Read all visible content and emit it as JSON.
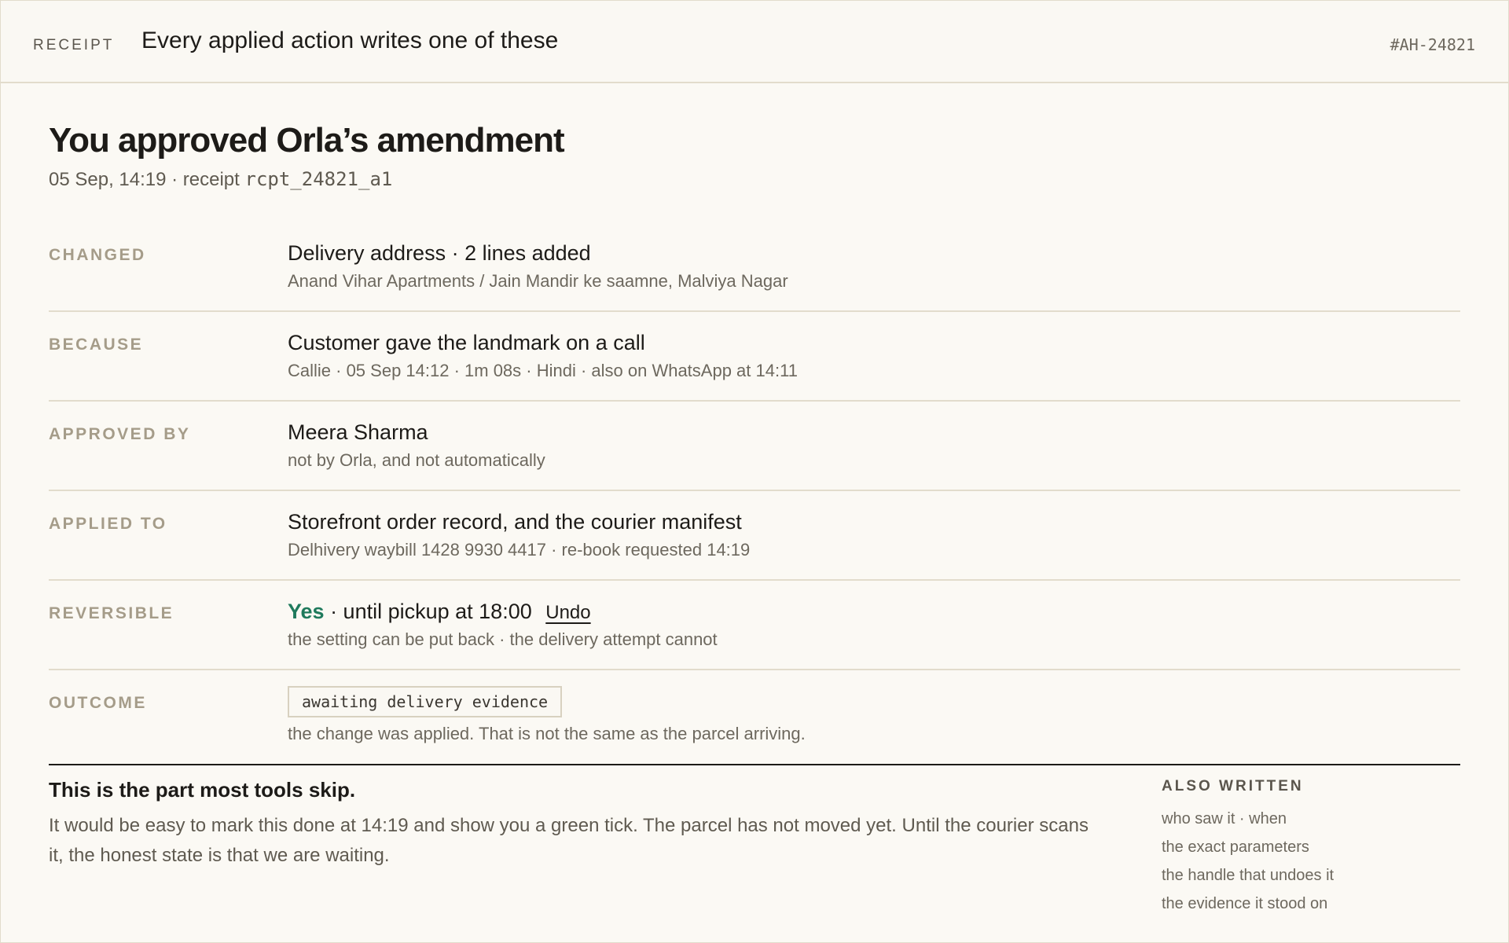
{
  "header": {
    "eyebrow": "RECEIPT",
    "title": "Every applied action writes one of these",
    "ref": "#AH-24821"
  },
  "receipt": {
    "headline": "You approved Orla’s amendment",
    "meta_prefix": "05 Sep, 14:19 · receipt",
    "receipt_id": "rcpt_24821_a1"
  },
  "rows": {
    "changed": {
      "label": "CHANGED",
      "main": "Delivery address · 2 lines added",
      "detail": "Anand Vihar Apartments / Jain Mandir ke saamne, Malviya Nagar"
    },
    "because": {
      "label": "BECAUSE",
      "main": "Customer gave the landmark on a call",
      "detail": "Callie · 05 Sep 14:12 · 1m 08s · Hindi · also on WhatsApp at 14:11"
    },
    "approved_by": {
      "label": "APPROVED BY",
      "main": "Meera Sharma",
      "detail": "not by Orla, and not automatically"
    },
    "applied_to": {
      "label": "APPLIED TO",
      "main": "Storefront order record, and the courier manifest",
      "detail": "Delhivery waybill 1428 9930 4417 · re-book requested 14:19"
    },
    "reversible": {
      "label": "REVERSIBLE",
      "yes": "Yes",
      "main_rest": " · until pickup at 18:00",
      "undo": "Undo",
      "detail": "the setting can be put back · the delivery attempt cannot"
    },
    "outcome": {
      "label": "OUTCOME",
      "status": "awaiting delivery evidence",
      "detail": "the change was applied. That is not the same as the parcel arriving."
    }
  },
  "note": {
    "title": "This is the part most tools skip.",
    "body": "It would be easy to mark this done at 14:19 and show you a green tick. The parcel has not moved yet. Until the courier scans it, the honest state is that we are waiting."
  },
  "also_written": {
    "heading": "ALSO WRITTEN",
    "items": [
      "who saw it · when",
      "the exact parameters",
      "the handle that undoes it",
      "the evidence it stood on"
    ]
  },
  "colors": {
    "background": "#fbf9f4",
    "border": "#e2dccc",
    "label": "#a59c89",
    "accent_yes": "#1f7a5c",
    "text": "#1d1b18"
  }
}
